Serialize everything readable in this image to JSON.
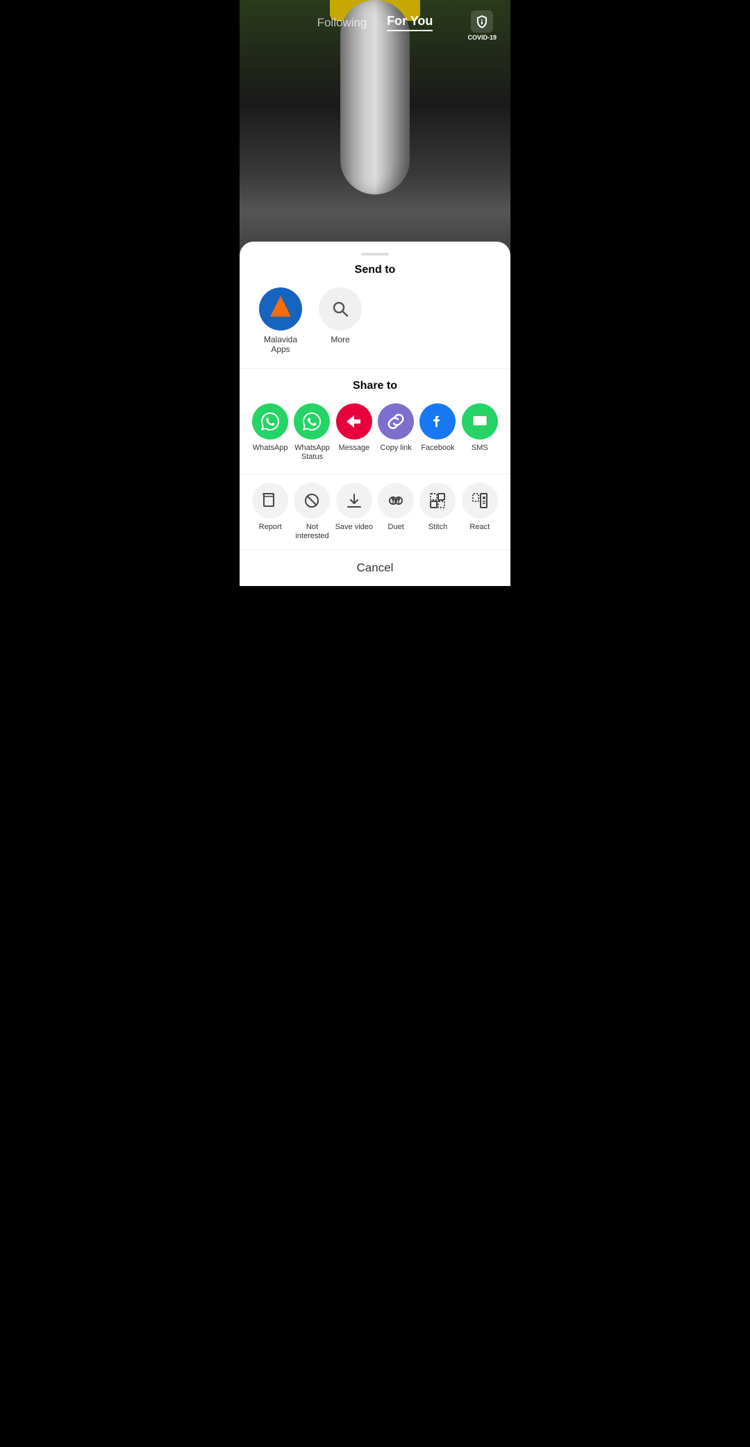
{
  "header": {
    "following_label": "Following",
    "foryou_label": "For You",
    "divider": "·",
    "covid_label": "COVID-19"
  },
  "send_to": {
    "title": "Send to",
    "contacts": [
      {
        "id": "malavida",
        "name": "Malavida\nApps",
        "type": "app"
      },
      {
        "id": "more",
        "name": "More",
        "type": "search"
      }
    ]
  },
  "share_to": {
    "title": "Share to",
    "items": [
      {
        "id": "whatsapp",
        "label": "WhatsApp",
        "color": "#25d366"
      },
      {
        "id": "whatsapp-status",
        "label": "WhatsApp\nStatus",
        "color": "#25d366"
      },
      {
        "id": "message",
        "label": "Message",
        "color": "#e8003d"
      },
      {
        "id": "copy-link",
        "label": "Copy link",
        "color": "#7c6fcd"
      },
      {
        "id": "facebook",
        "label": "Facebook",
        "color": "#1877f2"
      },
      {
        "id": "sms",
        "label": "SMS",
        "color": "#25d366"
      }
    ]
  },
  "actions": {
    "items": [
      {
        "id": "report",
        "label": "Report"
      },
      {
        "id": "not-interested",
        "label": "Not\ninterested"
      },
      {
        "id": "save-video",
        "label": "Save video"
      },
      {
        "id": "duet",
        "label": "Duet"
      },
      {
        "id": "stitch",
        "label": "Stitch"
      },
      {
        "id": "react",
        "label": "React"
      }
    ]
  },
  "cancel_label": "Cancel"
}
